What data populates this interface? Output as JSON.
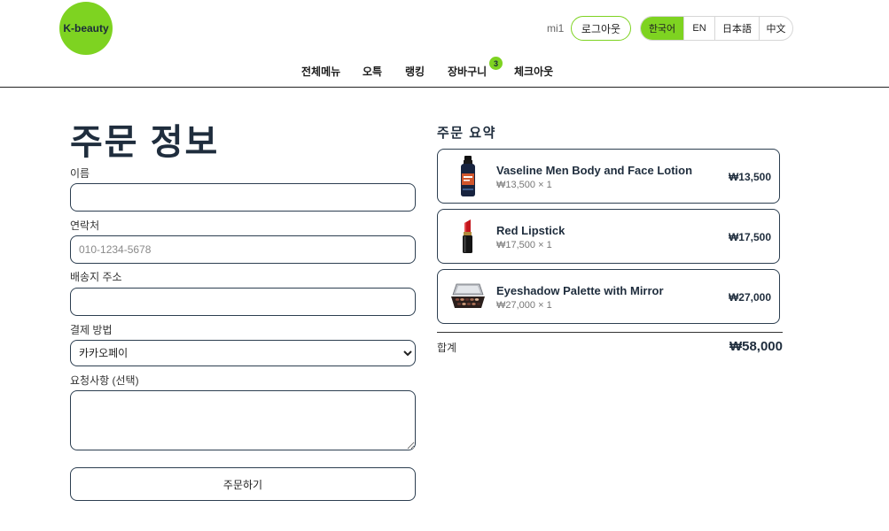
{
  "header": {
    "logo_text": "K-beauty",
    "username": "mi1",
    "logout_label": "로그아웃",
    "languages": [
      {
        "label": "한국어"
      },
      {
        "label": "EN"
      },
      {
        "label": "日本語"
      },
      {
        "label": "中文"
      }
    ],
    "active_language_index": 0,
    "nav": [
      {
        "label": "전체메뉴"
      },
      {
        "label": "오특"
      },
      {
        "label": "랭킹"
      },
      {
        "label": "장바구니",
        "badge": "3"
      },
      {
        "label": "체크아웃"
      }
    ]
  },
  "order_form": {
    "title": "주문 정보",
    "fields": {
      "name": {
        "label": "이름"
      },
      "phone": {
        "label": "연락처",
        "placeholder": "010-1234-5678"
      },
      "address": {
        "label": "배송지 주소"
      },
      "payment": {
        "label": "결제 방법",
        "selected": "카카오페이"
      },
      "request": {
        "label": "요청사항 (선택)"
      }
    },
    "submit_label": "주문하기"
  },
  "summary": {
    "title": "주문 요약",
    "items": [
      {
        "name": "Vaseline Men Body and Face Lotion",
        "detail": "₩13,500 × 1",
        "price": "₩13,500",
        "image": "lotion-bottle-icon"
      },
      {
        "name": "Red Lipstick",
        "detail": "₩17,500 × 1",
        "price": "₩17,500",
        "image": "lipstick-icon"
      },
      {
        "name": "Eyeshadow Palette with Mirror",
        "detail": "₩27,000 × 1",
        "price": "₩27,000",
        "image": "eyeshadow-palette-icon"
      }
    ],
    "total_label": "합계",
    "total_value": "₩58,000"
  },
  "colors": {
    "accent": "#7ED321",
    "text": "#1F2D3D",
    "border": "#2C3E50"
  }
}
